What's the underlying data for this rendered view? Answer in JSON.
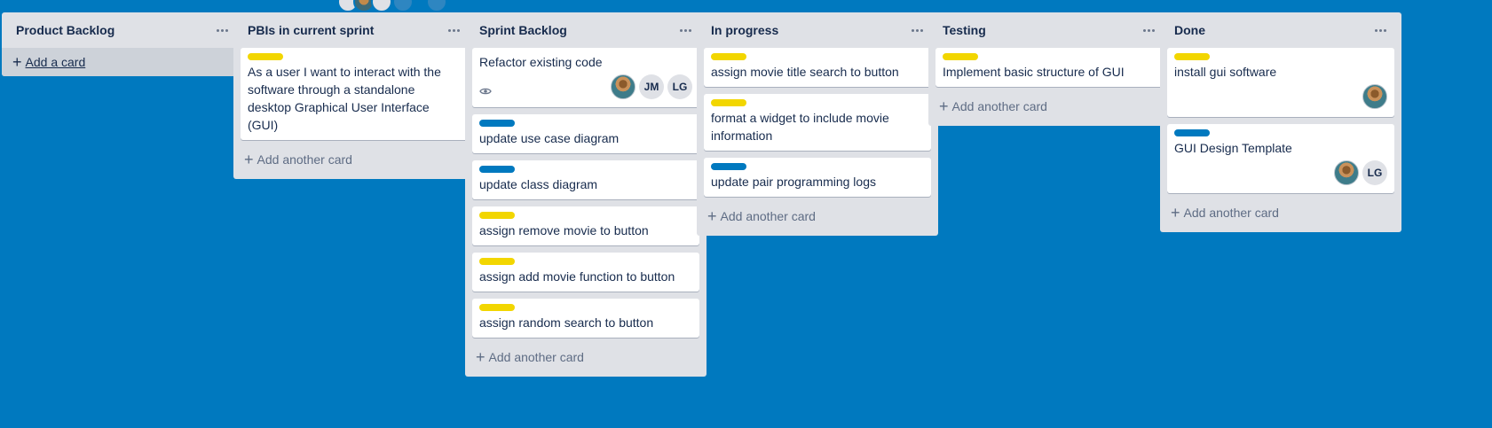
{
  "lists": [
    {
      "title": "Product Backlog",
      "add_label": "Add a card",
      "cards": []
    },
    {
      "title": "PBIs in current sprint",
      "add_label": "Add another card",
      "cards": [
        {
          "label": "yellow",
          "text": "As a user I want to interact with the software through a standalone desktop Graphical User Interface (GUI)"
        }
      ]
    },
    {
      "title": "Sprint Backlog",
      "add_label": "Add another card",
      "cards": [
        {
          "label": "",
          "text": "Refactor existing code",
          "watch": true,
          "members": [
            "photo",
            "JM",
            "LG"
          ]
        },
        {
          "label": "blue",
          "text": "update use case diagram"
        },
        {
          "label": "blue",
          "text": "update class diagram"
        },
        {
          "label": "yellow",
          "text": "assign remove movie to button"
        },
        {
          "label": "yellow",
          "text": "assign add movie function to button"
        },
        {
          "label": "yellow",
          "text": "assign random search to button"
        }
      ]
    },
    {
      "title": "In progress",
      "add_label": "Add another card",
      "cards": [
        {
          "label": "yellow",
          "text": "assign movie title search to button"
        },
        {
          "label": "yellow",
          "text": "format a widget to include movie information"
        },
        {
          "label": "blue",
          "text": "update pair programming logs"
        }
      ]
    },
    {
      "title": "Testing",
      "add_label": "Add another card",
      "cards": [
        {
          "label": "yellow",
          "text": "Implement basic structure of GUI"
        }
      ]
    },
    {
      "title": "Done",
      "add_label": "Add another card",
      "cards": [
        {
          "label": "yellow",
          "text": "install gui software",
          "members": [
            "photo"
          ]
        },
        {
          "label": "blue",
          "text": "GUI Design Template",
          "members": [
            "photo",
            "LG"
          ]
        }
      ]
    }
  ],
  "colors": {
    "board_bg": "#0079bf",
    "label_yellow": "#f2d600",
    "label_blue": "#0079bf",
    "list_bg": "#dfe1e6"
  },
  "icons": {
    "menu": "ellipsis-icon",
    "plus": "plus-icon",
    "watch": "eye-icon"
  }
}
